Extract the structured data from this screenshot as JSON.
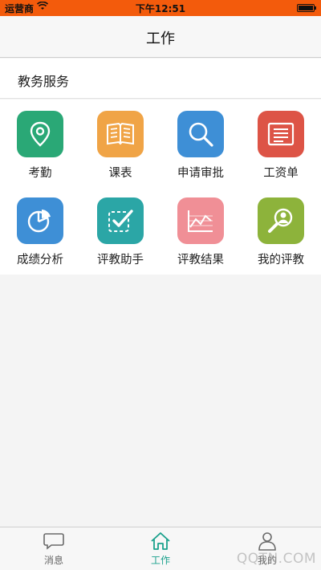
{
  "status_bar": {
    "carrier": "运营商",
    "time": "下午12:51",
    "battery_level": 1.0
  },
  "nav": {
    "title": "工作"
  },
  "section": {
    "title": "教务服务"
  },
  "tiles": [
    {
      "label": "考勤",
      "icon": "location-pin-icon",
      "color": "#2aa876"
    },
    {
      "label": "课表",
      "icon": "book-icon",
      "color": "#f0a446"
    },
    {
      "label": "申请审批",
      "icon": "magnifier-icon",
      "color": "#3e8fd6"
    },
    {
      "label": "工资单",
      "icon": "document-list-icon",
      "color": "#dd5446"
    },
    {
      "label": "成绩分析",
      "icon": "pie-chart-icon",
      "color": "#3e8fd6"
    },
    {
      "label": "评教助手",
      "icon": "checkbox-icon",
      "color": "#2ba6a6"
    },
    {
      "label": "评教结果",
      "icon": "line-chart-icon",
      "color": "#f08f96"
    },
    {
      "label": "我的评教",
      "icon": "person-search-icon",
      "color": "#8db33b"
    }
  ],
  "tabs": [
    {
      "label": "消息",
      "icon": "chat-bubble-icon",
      "active": false
    },
    {
      "label": "工作",
      "icon": "home-icon",
      "active": true
    },
    {
      "label": "我的",
      "icon": "person-icon",
      "active": false
    }
  ],
  "watermark": "QQTN.COM"
}
